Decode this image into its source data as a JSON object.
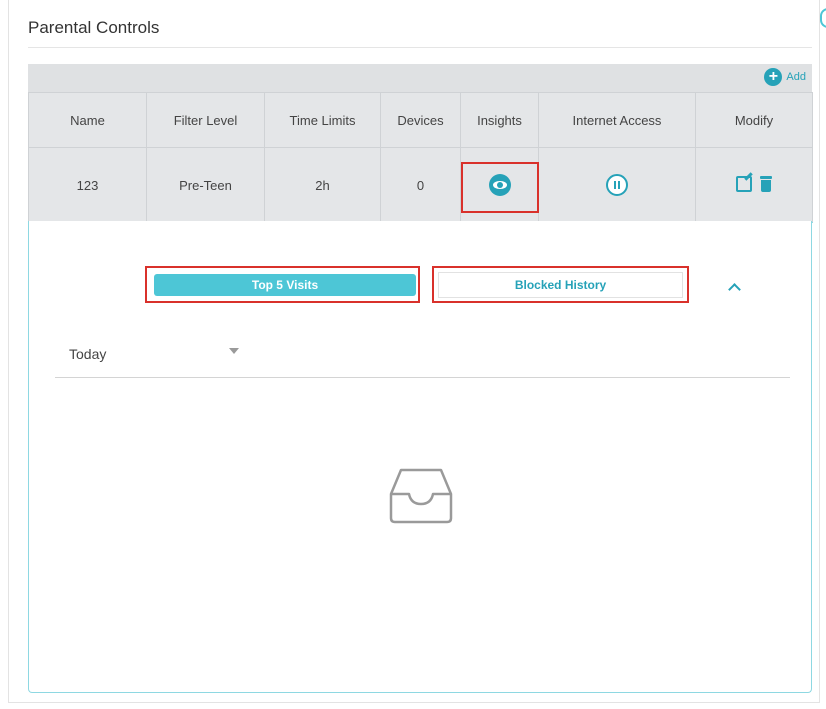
{
  "page": {
    "title": "Parental Controls"
  },
  "toolbar": {
    "add_label": "Add",
    "add_icon": "plus-circle-icon"
  },
  "table": {
    "headers": [
      "Name",
      "Filter Level",
      "Time Limits",
      "Devices",
      "Insights",
      "Internet Access",
      "Modify"
    ],
    "rows": [
      {
        "name": "123",
        "filter_level": "Pre-Teen",
        "time_limits": "2h",
        "devices": "0"
      }
    ]
  },
  "insights": {
    "tabs": {
      "top_visits": "Top 5 Visits",
      "blocked_history": "Blocked History"
    },
    "active_tab": "top_visits",
    "period": {
      "selected": "Today"
    },
    "empty_icon": "empty-inbox-icon"
  },
  "colors": {
    "accent": "#26a2b8",
    "tab_active": "#4dc6d6",
    "highlight": "#d9312b",
    "header_bg": "#e4e6e8"
  }
}
